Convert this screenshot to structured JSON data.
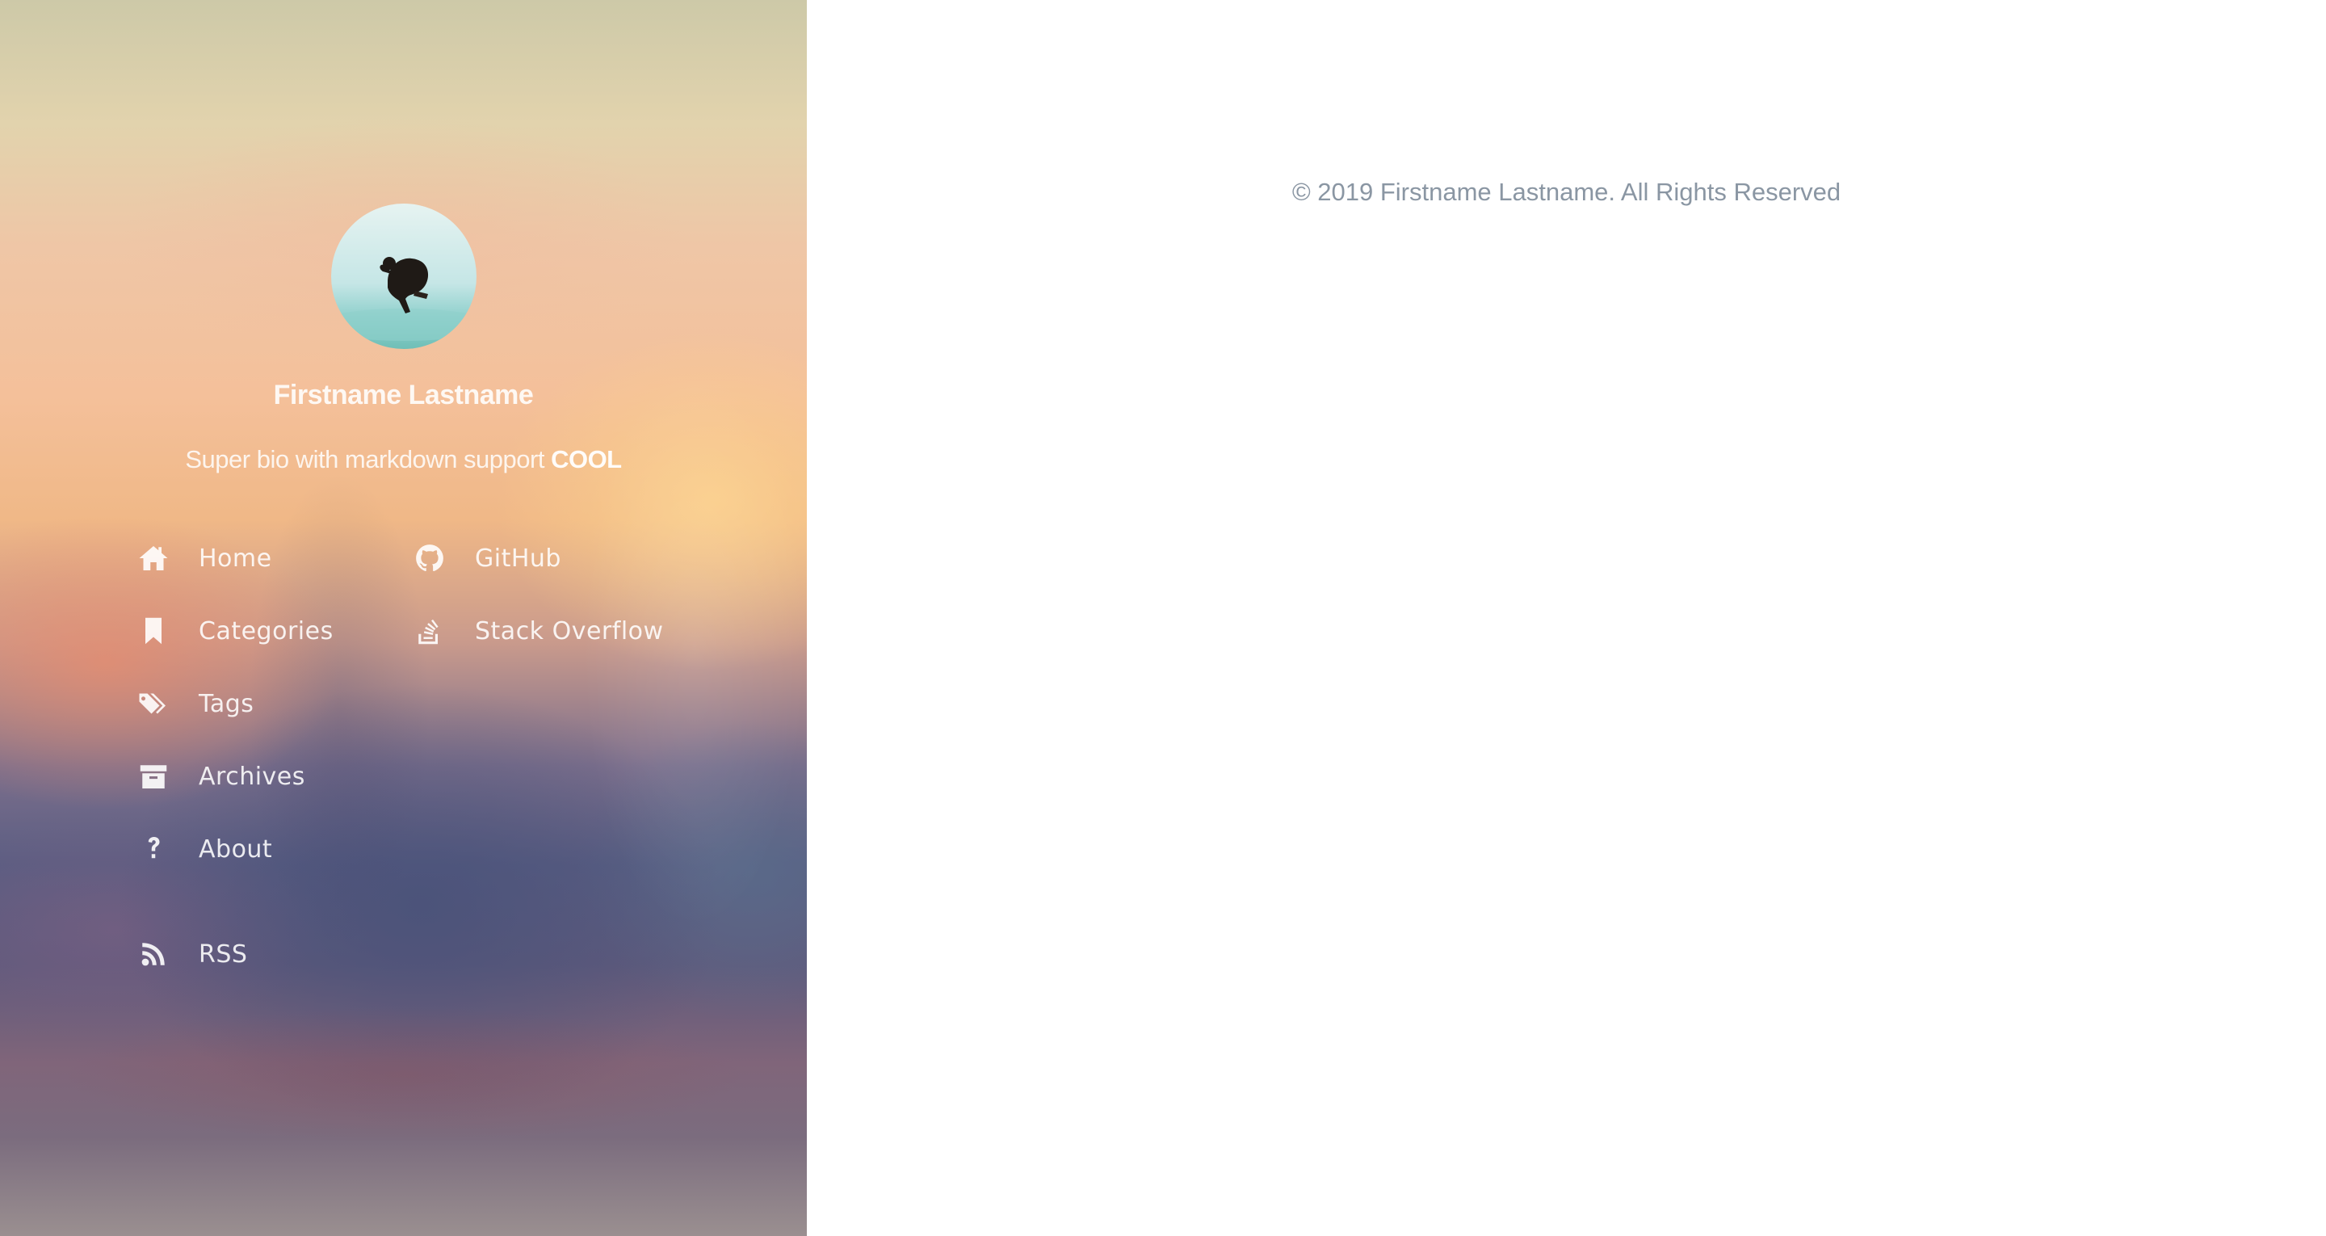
{
  "author": {
    "name": "Firstname Lastname",
    "bio_prefix": "Super bio with markdown support ",
    "bio_bold": "COOL"
  },
  "nav": {
    "left": [
      {
        "label": "Home",
        "icon": "home-icon"
      },
      {
        "label": "Categories",
        "icon": "bookmark-icon"
      },
      {
        "label": "Tags",
        "icon": "tags-icon"
      },
      {
        "label": "Archives",
        "icon": "archive-icon"
      },
      {
        "label": "About",
        "icon": "question-icon"
      }
    ],
    "right": [
      {
        "label": "GitHub",
        "icon": "github-icon"
      },
      {
        "label": "Stack Overflow",
        "icon": "stack-overflow-icon"
      }
    ],
    "rss": {
      "label": "RSS",
      "icon": "rss-icon"
    }
  },
  "footer": {
    "copyright": "© 2019 Firstname Lastname. All Rights Reserved"
  }
}
